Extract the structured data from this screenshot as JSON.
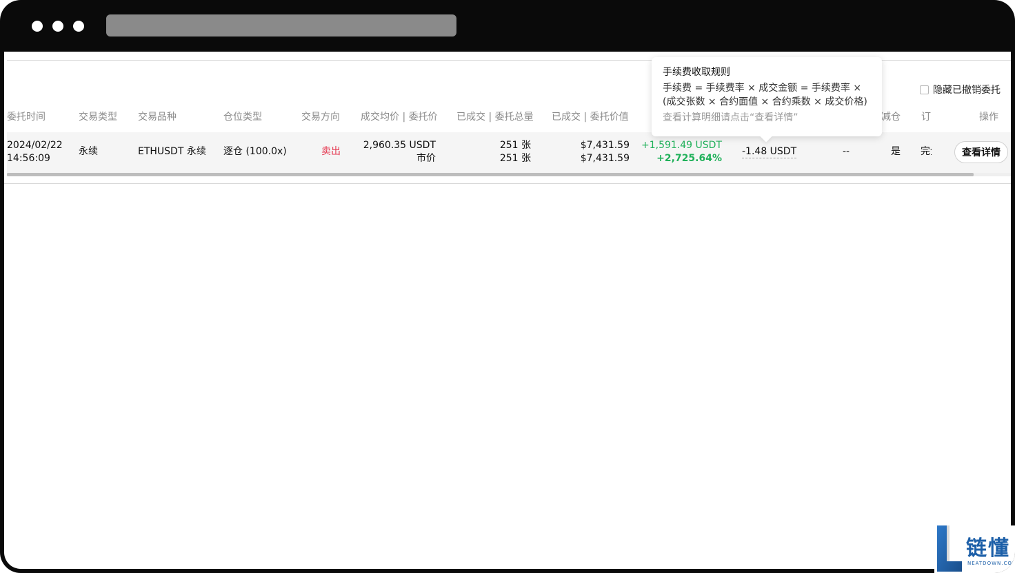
{
  "browser": {
    "address": ""
  },
  "table": {
    "hide_cancelled_label": "隐藏已撤销委托",
    "headers": {
      "time": "委托时间",
      "trade_type": "交易类型",
      "symbol": "交易品种",
      "margin_type": "仓位类型",
      "direction": "交易方向",
      "avg_price": "成交均价 | 委托价",
      "filled_qty": "已成交 | 委托总量",
      "filled_value": "已成交 | 委托价值",
      "reduce": "减仓",
      "order": "订单",
      "action": "操作"
    },
    "row": {
      "date": "2024/02/22",
      "time": "14:56:09",
      "trade_type": "永续",
      "symbol": "ETHUSDT 永续",
      "margin_type": "逐仓 (100.0x)",
      "direction": "卖出",
      "avg_price": "2,960.35 USDT",
      "order_price": "市价",
      "filled_qty": "251 张",
      "total_qty": "251 张",
      "filled_value": "$7,431.59",
      "order_value": "$7,431.59",
      "pnl": "+1,591.49 USDT",
      "pnl_pct": "+2,725.64%",
      "fee": "-1.48 USDT",
      "col_dash": "--",
      "reduce": "是",
      "status": "完全",
      "detail_button": "查看详情"
    }
  },
  "tooltip": {
    "title": "手续费收取规则",
    "body": "手续费 = 手续费率 × 成交金额 = 手续费率 × (成交张数 × 合约面值 × 合约乘数 × 成交价格)",
    "hint": "查看计算明细请点击“查看详情”"
  },
  "watermark": {
    "text": "链懂",
    "sub": "NEATDOWN.COM"
  },
  "colors": {
    "sell": "#e5374f",
    "profit": "#20b15a",
    "brand": "#1c5fa8"
  }
}
